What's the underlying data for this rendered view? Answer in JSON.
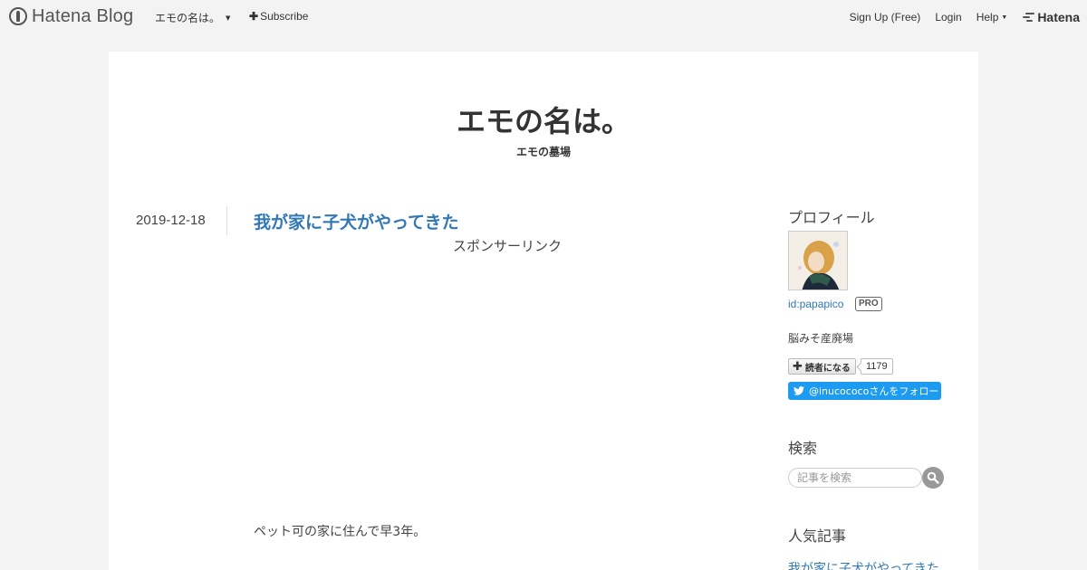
{
  "topbar": {
    "logo_text": "Hatena Blog",
    "blog_menu_label": "エモの名は。",
    "subscribe_label": "Subscribe",
    "signup_label": "Sign Up (Free)",
    "login_label": "Login",
    "help_label": "Help",
    "hatena_label": "Hatena"
  },
  "blog": {
    "title": "エモの名は。",
    "description": "エモの墓場"
  },
  "entry": {
    "date": "2019-12-18",
    "title": "我が家に子犬がやってきた",
    "sponsored_label": "スポンサーリンク",
    "body_first_line": "ペット可の家に住んで早3年。"
  },
  "sidebar": {
    "profile": {
      "heading": "プロフィール",
      "user_id": "id:papapico",
      "pro_badge": "PRO",
      "blog_nickname": "脳みそ産廃場",
      "reader_button_label": "読者になる",
      "reader_count": "1179",
      "twitter_follow_label": "@inucococoさんをフォロー"
    },
    "search": {
      "heading": "検索",
      "placeholder": "記事を検索"
    },
    "popular": {
      "heading": "人気記事",
      "items": [
        "我が家に子犬がやってきた"
      ]
    }
  },
  "colors": {
    "background": "#f3f3f3",
    "link": "#3278b6",
    "twitter": "#1d9bf0"
  }
}
